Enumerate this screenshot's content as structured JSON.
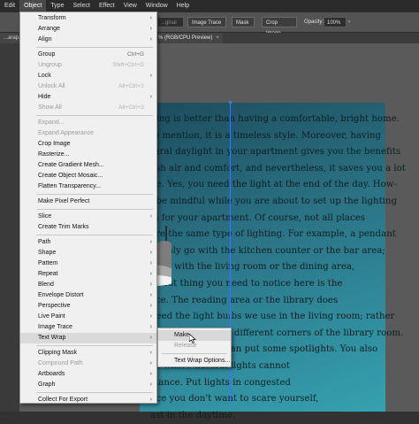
{
  "menubar": {
    "items": [
      "Edit",
      "Object",
      "Type",
      "Select",
      "Effect",
      "View",
      "Window",
      "Help"
    ],
    "active": "Object"
  },
  "control_bar": {
    "field_partial": "...ginal",
    "image_trace": "Image Trace",
    "mask": "Mask",
    "crop_image": "Crop Image",
    "opacity_label": "Opacity:",
    "opacity_value": "100%"
  },
  "tabs": {
    "left_file": "...arap.ai*",
    "right_doc": "% (RGB/CPU Preview)",
    "close": "×"
  },
  "object_menu": {
    "items": [
      {
        "label": "Transform",
        "shortcut": "",
        "submenu": true,
        "disabled": false
      },
      {
        "label": "Arrange",
        "shortcut": "",
        "submenu": true,
        "disabled": false
      },
      {
        "label": "Align",
        "shortcut": "",
        "submenu": true,
        "disabled": false
      },
      {
        "sep": true
      },
      {
        "label": "Group",
        "shortcut": "Ctrl+G",
        "submenu": false,
        "disabled": false
      },
      {
        "label": "Ungroup",
        "shortcut": "Shift+Ctrl+G",
        "submenu": false,
        "disabled": true
      },
      {
        "label": "Lock",
        "shortcut": "",
        "submenu": true,
        "disabled": false
      },
      {
        "label": "Unlock All",
        "shortcut": "Alt+Ctrl+2",
        "submenu": false,
        "disabled": true
      },
      {
        "label": "Hide",
        "shortcut": "",
        "submenu": true,
        "disabled": false
      },
      {
        "label": "Show All",
        "shortcut": "Alt+Ctrl+3",
        "submenu": false,
        "disabled": true
      },
      {
        "sep": true
      },
      {
        "label": "Expand...",
        "shortcut": "",
        "submenu": false,
        "disabled": true
      },
      {
        "label": "Expand Appearance",
        "shortcut": "",
        "submenu": false,
        "disabled": true
      },
      {
        "label": "Crop Image",
        "shortcut": "",
        "submenu": false,
        "disabled": false
      },
      {
        "label": "Rasterize...",
        "shortcut": "",
        "submenu": false,
        "disabled": false
      },
      {
        "label": "Create Gradient Mesh...",
        "shortcut": "",
        "submenu": false,
        "disabled": false
      },
      {
        "label": "Create Object Mosaic...",
        "shortcut": "",
        "submenu": false,
        "disabled": false
      },
      {
        "label": "Flatten Transparency...",
        "shortcut": "",
        "submenu": false,
        "disabled": false
      },
      {
        "sep": true
      },
      {
        "label": "Make Pixel Perfect",
        "shortcut": "",
        "submenu": false,
        "disabled": false
      },
      {
        "sep": true
      },
      {
        "label": "Slice",
        "shortcut": "",
        "submenu": true,
        "disabled": false
      },
      {
        "label": "Create Trim Marks",
        "shortcut": "",
        "submenu": false,
        "disabled": false
      },
      {
        "sep": true
      },
      {
        "label": "Path",
        "shortcut": "",
        "submenu": true,
        "disabled": false
      },
      {
        "label": "Shape",
        "shortcut": "",
        "submenu": true,
        "disabled": false
      },
      {
        "label": "Pattern",
        "shortcut": "",
        "submenu": true,
        "disabled": false
      },
      {
        "label": "Repeat",
        "shortcut": "",
        "submenu": true,
        "disabled": false
      },
      {
        "label": "Blend",
        "shortcut": "",
        "submenu": true,
        "disabled": false
      },
      {
        "label": "Envelope Distort",
        "shortcut": "",
        "submenu": true,
        "disabled": false
      },
      {
        "label": "Perspective",
        "shortcut": "",
        "submenu": true,
        "disabled": false
      },
      {
        "label": "Live Paint",
        "shortcut": "",
        "submenu": true,
        "disabled": false
      },
      {
        "label": "Image Trace",
        "shortcut": "",
        "submenu": true,
        "disabled": false
      },
      {
        "label": "Text Wrap",
        "shortcut": "",
        "submenu": true,
        "disabled": false,
        "highlighted": true
      },
      {
        "sep": true
      },
      {
        "label": "Clipping Mask",
        "shortcut": "",
        "submenu": true,
        "disabled": false
      },
      {
        "label": "Compound Path",
        "shortcut": "",
        "submenu": true,
        "disabled": true
      },
      {
        "label": "Artboards",
        "shortcut": "",
        "submenu": true,
        "disabled": false
      },
      {
        "label": "Graph",
        "shortcut": "",
        "submenu": true,
        "disabled": false
      },
      {
        "sep": true
      },
      {
        "label": "Collect For Export",
        "shortcut": "",
        "submenu": true,
        "disabled": false
      }
    ]
  },
  "text_wrap_submenu": {
    "items": [
      {
        "label": "Make",
        "disabled": false,
        "highlighted": true
      },
      {
        "label": "Release",
        "disabled": true
      },
      {
        "sep": true
      },
      {
        "label": "Text Wrap Options...",
        "disabled": false
      }
    ]
  },
  "document": {
    "lines": [
      "hing is better than having a comfortable, bright home.",
      "to mention, it is a timeless style. Moreover, having",
      "tural daylight in your apartment gives you the benefits",
      "esh air and comfort, and nevertheless, it saves you a lot",
      "ne. Yes, you need the light at the end of the day. How-",
      ", be mindful while you are about to set up the lighting",
      "m for your apartment. Of course, not all places",
      "are the same type of lighting. For example, a pendant",
      "ill only go with the kitchen counter or the bar area;",
      "goes with the living room or the dining area,",
      "e first thing you need to notice here is the",
      "ace. The reading area or the library does",
      "need the light bulbs we use in the living room; rather",
      "different lamps in different corners of the library room.",
      "e corridors, you can put some spotlights. You also",
      "es where natural lights cannot",
      "stance. Put lights in congested",
      "nce you don't want to scare yourself,",
      "ast in the daytime."
    ]
  }
}
